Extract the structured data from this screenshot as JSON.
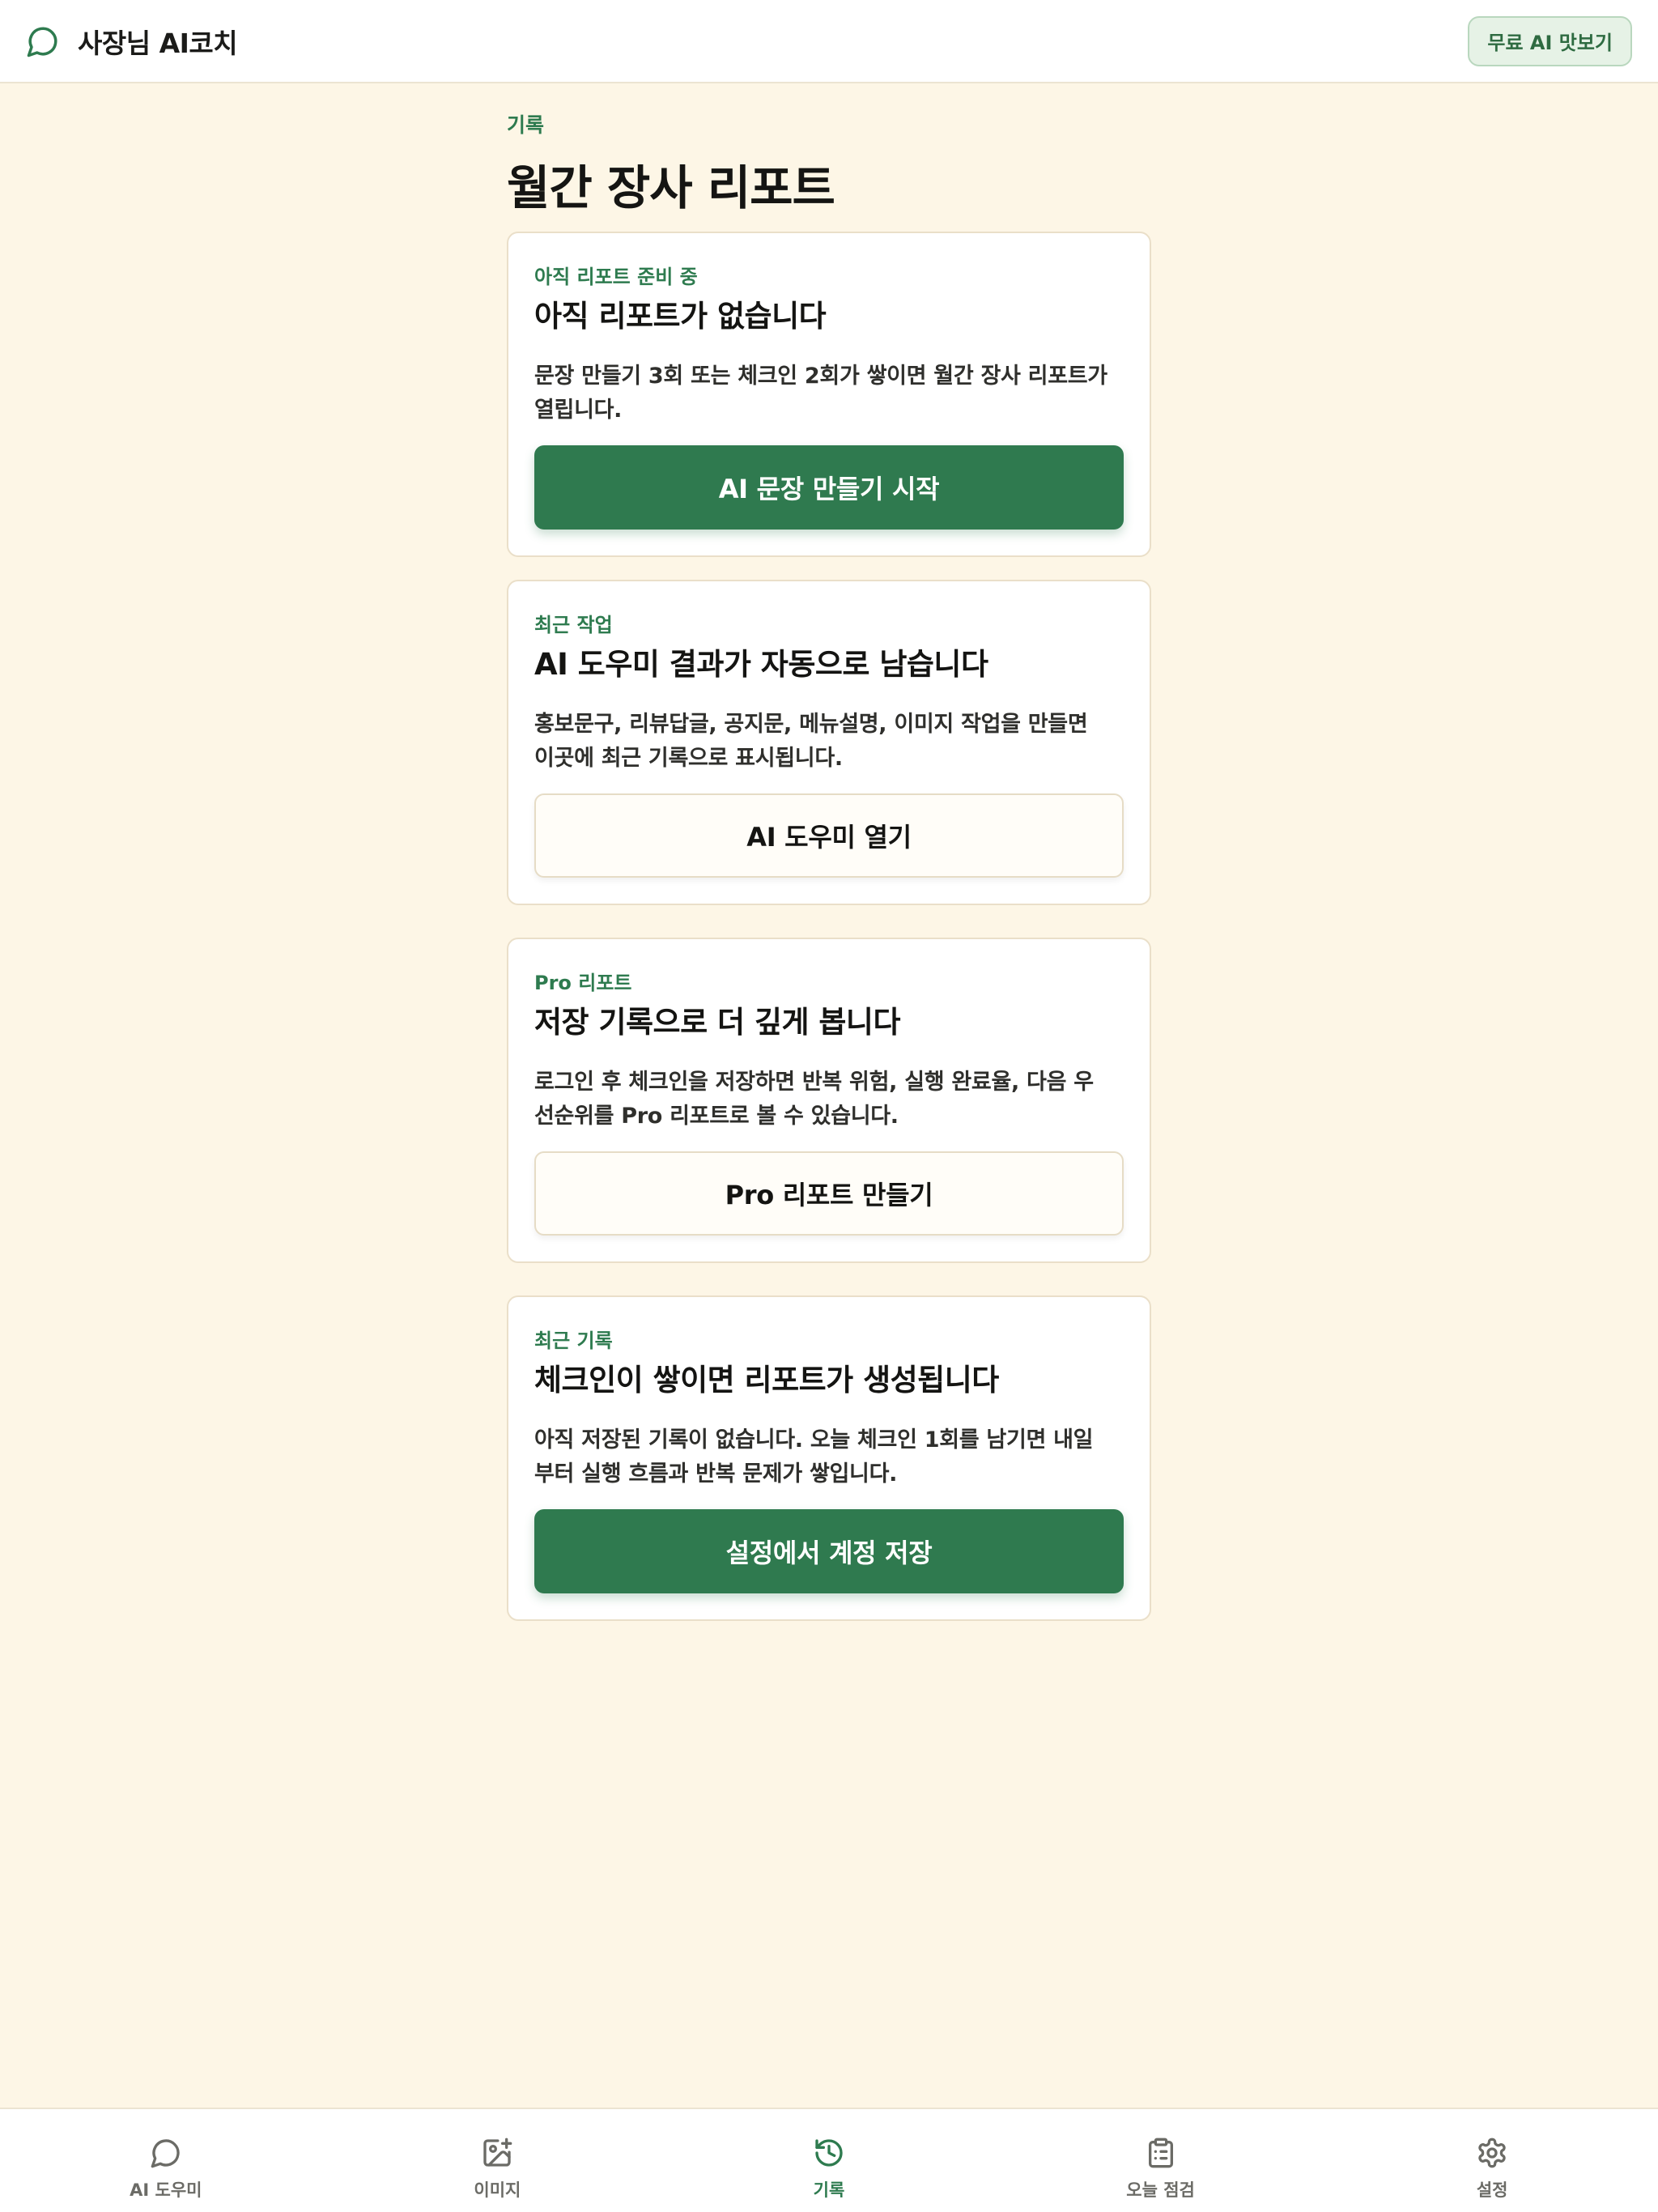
{
  "header": {
    "icon": "chat-bubble-icon",
    "title": "사장님 AI코치",
    "trial_button": "무료 AI 맛보기"
  },
  "page": {
    "eyebrow": "기록",
    "title": "월간 장사 리포트"
  },
  "cards": [
    {
      "label": "아직 리포트 준비 중",
      "title": "아직 리포트가 없습니다",
      "body_line1": "문장 만들기 3회 또는 체크인 2회가 쌓이면 월간 장사 리포트가",
      "body_line2": "열립니다.",
      "button": "AI 문장 만들기 시작",
      "button_style": "primary"
    },
    {
      "label": "최근 작업",
      "title": "AI 도우미 결과가 자동으로 남습니다",
      "body_line1": "홍보문구, 리뷰답글, 공지문, 메뉴설명, 이미지 작업을 만들면",
      "body_line2": "이곳에 최근 기록으로 표시됩니다.",
      "button": "AI 도우미 열기",
      "button_style": "secondary"
    },
    {
      "label": "Pro 리포트",
      "title": "저장 기록으로 더 깊게 봅니다",
      "body_line1": "로그인 후 체크인을 저장하면 반복 위험, 실행 완료율, 다음 우",
      "body_line2": "선순위를 Pro 리포트로 볼 수 있습니다.",
      "button": "Pro 리포트 만들기",
      "button_style": "secondary"
    },
    {
      "label": "최근 기록",
      "title": "체크인이 쌓이면 리포트가 생성됩니다",
      "body_line1": "아직 저장된 기록이 없습니다. 오늘 체크인 1회를 남기면 내일",
      "body_line2": "부터 실행 흐름과 반복 문제가 쌓입니다.",
      "button": "설정에서 계정 저장",
      "button_style": "primary"
    }
  ],
  "bottom_nav": [
    {
      "label": "AI 도우미",
      "icon": "chat-bubble-icon",
      "active": false
    },
    {
      "label": "이미지",
      "icon": "image-edit-icon",
      "active": false
    },
    {
      "label": "기록",
      "icon": "history-icon",
      "active": true
    },
    {
      "label": "오늘 점검",
      "icon": "clipboard-icon",
      "active": false
    },
    {
      "label": "설정",
      "icon": "gear-icon",
      "active": false
    }
  ],
  "colors": {
    "background": "#fdf6e6",
    "accent": "#2f7a4f",
    "nav_active": "#2e7b4f",
    "nav_inactive": "#6b6b66"
  }
}
